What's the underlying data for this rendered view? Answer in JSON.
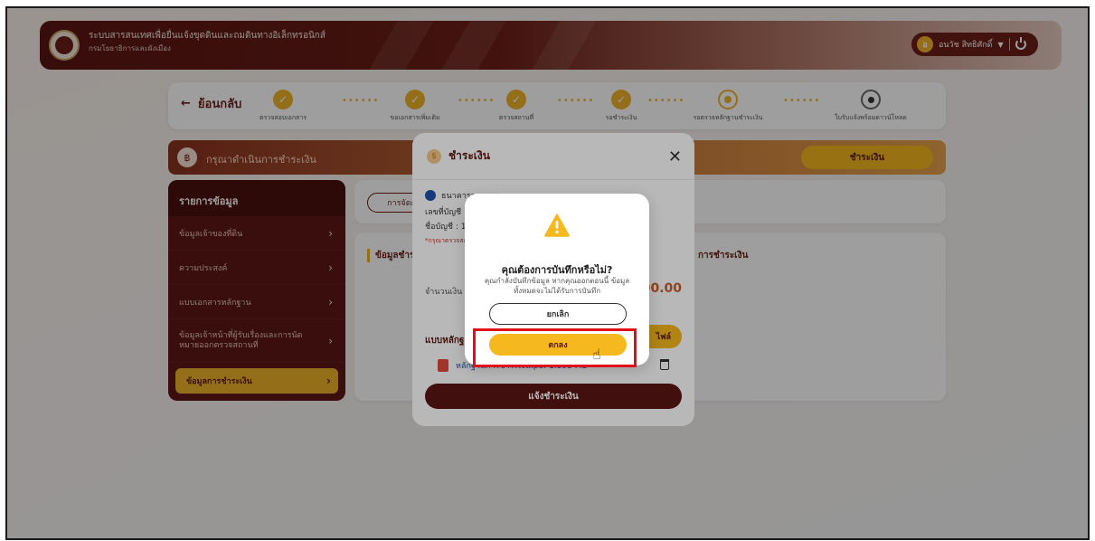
{
  "header": {
    "system_title": "ระบบสารสนเทศเพื่อยื่นแจ้งขุดดินและถมดินทางอิเล็กทรอนิกส์",
    "system_subtitle": "กรมโยธาธิการและผังเมือง",
    "user_initial": "อ",
    "user_name": "อนวัช สิทธิศักดิ์"
  },
  "stepper": {
    "back_label": "ย้อนกลับ",
    "steps": [
      {
        "label": "ตรวจสอบเอกสาร",
        "state": "done"
      },
      {
        "label": "ขอเอกสารเพิ่มเติม",
        "state": "done"
      },
      {
        "label": "ตรวจสถานที่",
        "state": "done"
      },
      {
        "label": "รอชำระเงิน",
        "state": "done"
      },
      {
        "label": "รอตรวจหลักฐานชำระเงิน",
        "state": "current"
      },
      {
        "label": "ใบรับแจ้งพร้อมดาวน์โหลด",
        "state": "todo"
      }
    ]
  },
  "notice": {
    "text": "กรุณาดำเนินการชำระเงิน",
    "pay_button": "ชำระเงิน"
  },
  "sidebar": {
    "title": "รายการข้อมูล",
    "items": [
      {
        "label": "ข้อมูลเจ้าของที่ดิน"
      },
      {
        "label": "ความประสงค์"
      },
      {
        "label": "แบบเอกสารหลักฐาน"
      },
      {
        "label": "ข้อมูลเจ้าหน้าที่ผู้รับเรื่องและการนัดหมายออกตรวจสถานที่"
      },
      {
        "label": "ข้อมูลการชำระเงิน"
      }
    ]
  },
  "main": {
    "manage_label": "การจัดการ",
    "card_title": "ข้อมูลชำระเงิน",
    "card_right_title": "การชำระเงิน"
  },
  "payment_modal": {
    "title": "ชำระเงิน",
    "bank_name": "ธนาคารกรุงเทพ",
    "account_no_label": "เลขที่บัญชี",
    "account_name_label": "ชื่อบัญชี : 1",
    "note_red": "*กรุณาตรวจสอบ... ไม่เกินจำนวนเท่านั้น หากพบยังไม่ชำระ...",
    "amount_label": "จำนวนเงิน",
    "amount_value": "500.00",
    "evidence_label": "แบบหลักฐาน",
    "upload_button": "ไฟล์",
    "file_name": "หลักฐานการชำระเงิน.pdf  1.393 MB",
    "submit_button": "แจ้งชำระเงิน"
  },
  "confirm_dialog": {
    "title": "คุณต้องการบันทึกหรือไม่?",
    "message": "คุณกำลังบันทึกข้อมูล หากคุณออกตอนนี้ ข้อมูลทั้งหมดจะไม่ได้รับการบันทึก",
    "cancel_button": "ยกเลิก",
    "ok_button": "ตกลง"
  },
  "colors": {
    "brand_maroon": "#5a1512",
    "accent_yellow": "#f5b81e",
    "highlight_red": "#e0101a"
  }
}
